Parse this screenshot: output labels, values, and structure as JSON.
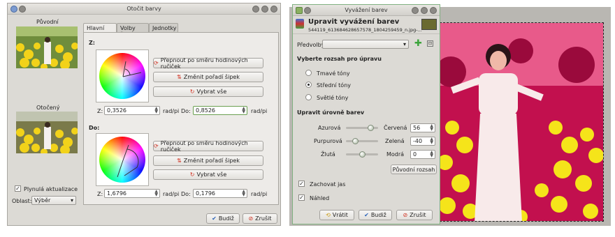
{
  "left_dialog": {
    "title": "Otočit barvy",
    "original_label": "Původní",
    "rotated_label": "Otočený",
    "smooth_update_label": "Plynulá aktualizace",
    "area_label": "Oblast:",
    "area_value": "Výběr",
    "tabs": [
      "Hlavní volby",
      "Volby šedé",
      "Jednotky"
    ],
    "from": {
      "heading": "Z:",
      "clockwise_button": "Přepnout po směru hodinových ručiček",
      "swap_button": "Změnit pořadí šipek",
      "select_all_button": "Vybrat vše",
      "z_label": "Z:",
      "z_value": "0,3526",
      "unit1": "rad/pi",
      "do_label": "Do:",
      "do_value": "0,8526",
      "unit2": "rad/pi"
    },
    "to": {
      "heading": "Do:",
      "clockwise_button": "Přepnout po směru hodinových ručiček",
      "swap_button": "Změnit pořadí šipek",
      "select_all_button": "Vybrat vše",
      "z_label": "Z:",
      "z_value": "1,6796",
      "unit1": "rad/pi",
      "do_label": "Do:",
      "do_value": "0,1796",
      "unit2": "rad/pi"
    },
    "ok_button": "Budiž",
    "cancel_button": "Zrušit"
  },
  "right_dialog": {
    "title": "Vyvážení barev",
    "header_title": "Upravit vyvážení barev",
    "header_subtitle": "544119_613684628657578_1804259459_n.jpg-...",
    "presets_label": "Předvolby:",
    "range_heading": "Vyberte rozsah pro úpravu",
    "ranges": [
      {
        "label": "Tmavé tóny",
        "selected": false
      },
      {
        "label": "Střední tóny",
        "selected": true
      },
      {
        "label": "Světlé tóny",
        "selected": false
      }
    ],
    "levels_heading": "Upravit úrovně barev",
    "sliders": [
      {
        "left": "Azurová",
        "right": "Červená",
        "value": "56",
        "fraction": 0.78
      },
      {
        "left": "Purpurová",
        "right": "Zelená",
        "value": "-40",
        "fraction": 0.3
      },
      {
        "left": "Žlutá",
        "right": "Modrá",
        "value": "0",
        "fraction": 0.5
      }
    ],
    "reset_range_button": "Původní rozsah",
    "preserve_label": "Zachovat jas",
    "preview_label": "Náhled",
    "reset_button": "Vrátit",
    "ok_button": "Budiž",
    "cancel_button": "Zrušit"
  },
  "colors": {
    "accent_green": "#3ca43c",
    "cancel_red": "#d03020",
    "magenta_tint": "#d8145a"
  }
}
